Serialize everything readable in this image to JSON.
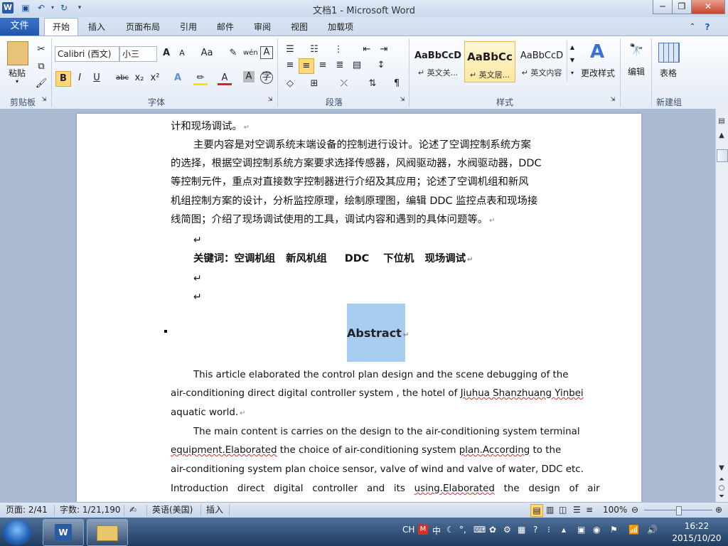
{
  "window": {
    "title": "文档1 - Microsoft Word",
    "app_icon": "W"
  },
  "qat": {
    "save_icon": "save-icon",
    "undo_icon": "undo-icon",
    "redo_icon": "redo-icon"
  },
  "tabs": [
    {
      "label": "文件"
    },
    {
      "label": "开始"
    },
    {
      "label": "插入"
    },
    {
      "label": "页面布局"
    },
    {
      "label": "引用"
    },
    {
      "label": "邮件"
    },
    {
      "label": "审阅"
    },
    {
      "label": "视图"
    },
    {
      "label": "加载项"
    }
  ],
  "ribbon": {
    "clipboard": {
      "label": "剪贴板",
      "paste": "粘贴"
    },
    "font": {
      "label": "字体",
      "font_name": "Calibri (西文)",
      "font_size": "小三",
      "grow": "A",
      "shrink": "A",
      "aa": "Aa",
      "bold": "B",
      "italic": "I",
      "underline": "U",
      "strike": "abc",
      "sub": "x₂",
      "sup": "x²",
      "a": "A"
    },
    "paragraph": {
      "label": "段落"
    },
    "styles": {
      "label": "样式",
      "tiles": [
        {
          "sample": "AaBbCcD",
          "name": "↵ 英文关..."
        },
        {
          "sample": "AaBbCc",
          "name": "↵ 英文居..."
        },
        {
          "sample": "AaBbCcD",
          "name": "↵ 英文内容"
        }
      ],
      "change_styles": "更改样式"
    },
    "editing": {
      "label": "编辑"
    },
    "table": {
      "label": "表格",
      "group": "新建组"
    }
  },
  "document": {
    "lines": [
      "计和现场调试。",
      "主要内容是对空调系统末端设备的控制进行设计。论述了空调控制系统方案",
      "的选择，根据空调控制系统方案要求选择传感器，风阀驱动器，水阀驱动器，DDC",
      "等控制元件，重点对直接数字控制器进行介绍及其应用；论述了空调机组和新风",
      "机组控制方案的设计，分析监控原理，绘制原理图，编辑 DDC 监控点表和现场接",
      "线简图；介绍了现场调试使用的工具，调试内容和遇到的具体问题等。"
    ],
    "keywords": "关键词：空调机组   新风机组     DDC    下位机   现场调试",
    "abstract_heading": "Abstract",
    "en_lines": [
      "This article elaborated the control plan design and the scene debugging of the",
      "air-conditioning direct digital controller system , the hotel of ",
      "aquatic world.",
      "The main content is carries on the design to the air-conditioning system terminal",
      "the choice of air-conditioning system ",
      "air-conditioning system plan choice sensor, valve of wind and valve of water, DDC etc.",
      "Introduction   direct   digital   controller   and   its   ",
      "the   design   of   air"
    ],
    "squiggles": {
      "hotel": "Jiuhua Shanzhuang Yinbei",
      "equipment": "equipment.Elaborated",
      "plan": "plan.According",
      "to_the": " to the",
      "using": "using.Elaborated"
    },
    "mark": "↵"
  },
  "status": {
    "page": "页面: 2/41",
    "words": "字数: 1/21,190",
    "language": "英语(美国)",
    "insert": "插入",
    "zoom": "100%"
  },
  "taskbar": {
    "ime": "CH",
    "ime_cn": "中",
    "time": "16:22",
    "date": "2015/10/20"
  }
}
